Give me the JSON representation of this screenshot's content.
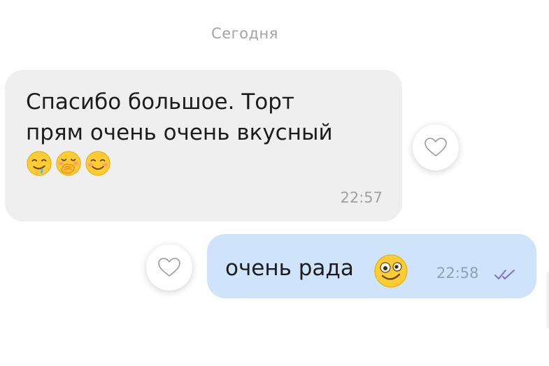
{
  "date_separator": "Сегодня",
  "messages": [
    {
      "direction": "incoming",
      "text": "Спасибо большое. Торт\nпрям очень очень вкусный",
      "emojis": [
        "drooling-face-emoji",
        "hand-over-mouth-emoji",
        "smiling-face-emoji"
      ],
      "time": "22:57",
      "bubble_color": "#efefef",
      "reaction_icon": "heart-outline-icon"
    },
    {
      "direction": "outgoing",
      "text": "очень рада",
      "emojis": [
        "zany-face-emoji"
      ],
      "time": "22:58",
      "status_icon": "double-check-icon",
      "status": "read",
      "bubble_color": "#cfe4fb",
      "reaction_icon": "heart-outline-icon"
    }
  ],
  "colors": {
    "check_color": "#7b6fd6",
    "emoji_yellow": "#ffcc33"
  }
}
